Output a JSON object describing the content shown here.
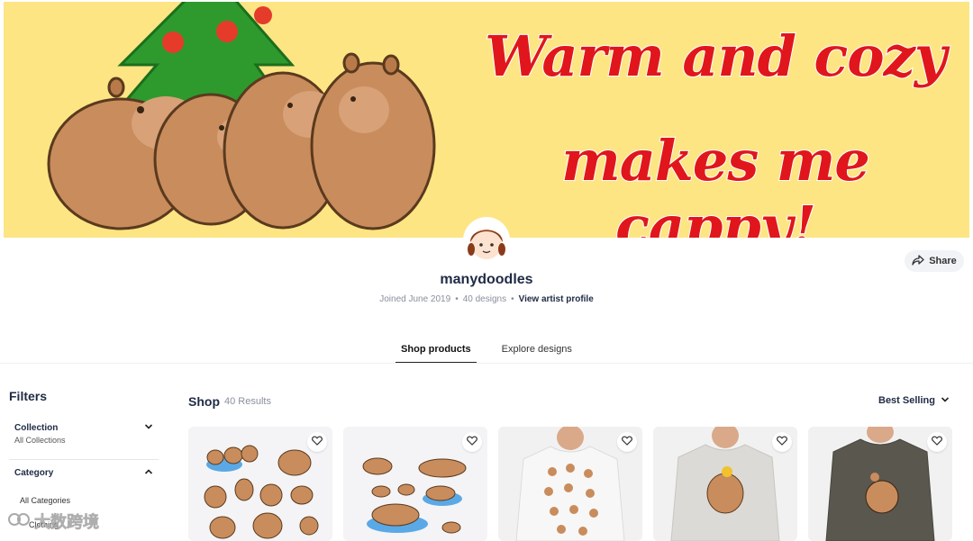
{
  "banner": {
    "line1": "Warm and cozy",
    "line2": "makes me cappy!",
    "background_color": "#fde584",
    "text_color": "#e0161c"
  },
  "artist": {
    "name": "manydoodles",
    "joined": "Joined June 2019",
    "designs": "40 designs",
    "profile_link": "View artist profile"
  },
  "share": {
    "label": "Share"
  },
  "tabs": [
    {
      "label": "Shop products",
      "active": true
    },
    {
      "label": "Explore designs",
      "active": false
    }
  ],
  "filters": {
    "title": "Filters",
    "collection": {
      "label": "Collection",
      "value": "All Collections"
    },
    "category": {
      "label": "Category",
      "options": [
        "All Categories",
        "Clothing"
      ]
    }
  },
  "shop": {
    "title": "Shop",
    "count": "40 Results",
    "sort": "Best Selling"
  },
  "products": [
    {
      "type": "stickers",
      "bg": "#f4f4f6"
    },
    {
      "type": "stickers",
      "bg": "#f4f4f6"
    },
    {
      "type": "t-shirt",
      "bg": "#f1f1f1",
      "shirt_color": "#f7f7f7"
    },
    {
      "type": "t-shirt",
      "bg": "#f1f1f1",
      "shirt_color": "#dcdad6"
    },
    {
      "type": "t-shirt",
      "bg": "#f1f1f1",
      "shirt_color": "#5a574f"
    }
  ],
  "watermark": {
    "text": "大数跨境"
  },
  "icons": [
    "share-icon",
    "chevron-down-icon",
    "chevron-up-icon",
    "heart-icon"
  ]
}
